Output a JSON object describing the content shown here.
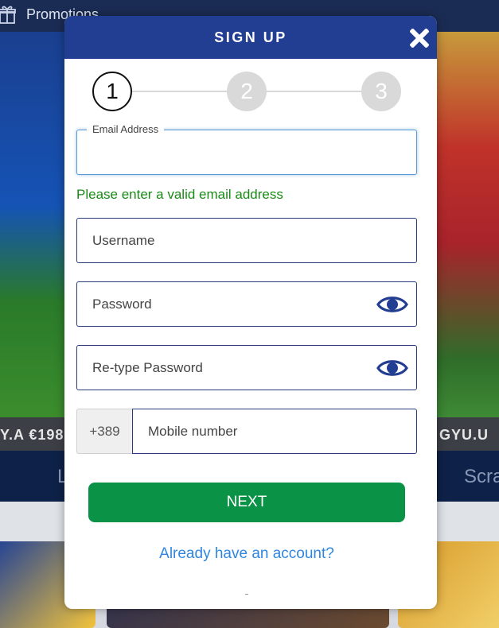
{
  "background": {
    "promo_label": "Promotions",
    "promo_icon": "gift-icon",
    "ticker_left": "Y.A €198",
    "ticker_right": "GYU.U",
    "nav_left": "L",
    "nav_right": "Scra"
  },
  "modal": {
    "title": "SIGN UP",
    "close_icon": "close-icon",
    "steps": [
      "1",
      "2",
      "3"
    ],
    "email": {
      "label": "Email Address",
      "value": "",
      "placeholder": ""
    },
    "email_hint": "Please enter a valid email address",
    "username": {
      "placeholder": "Username"
    },
    "password": {
      "placeholder": "Password"
    },
    "repassword": {
      "placeholder": "Re-type Password"
    },
    "mobile": {
      "prefix": "+389",
      "placeholder": "Mobile number"
    },
    "next_label": "NEXT",
    "login_link": "Already have an account?",
    "colors": {
      "header": "#223e93",
      "next_button": "#0a9246",
      "hint_text": "#1a8a17",
      "link": "#2f86e0",
      "eye_icon": "#223e93"
    }
  }
}
